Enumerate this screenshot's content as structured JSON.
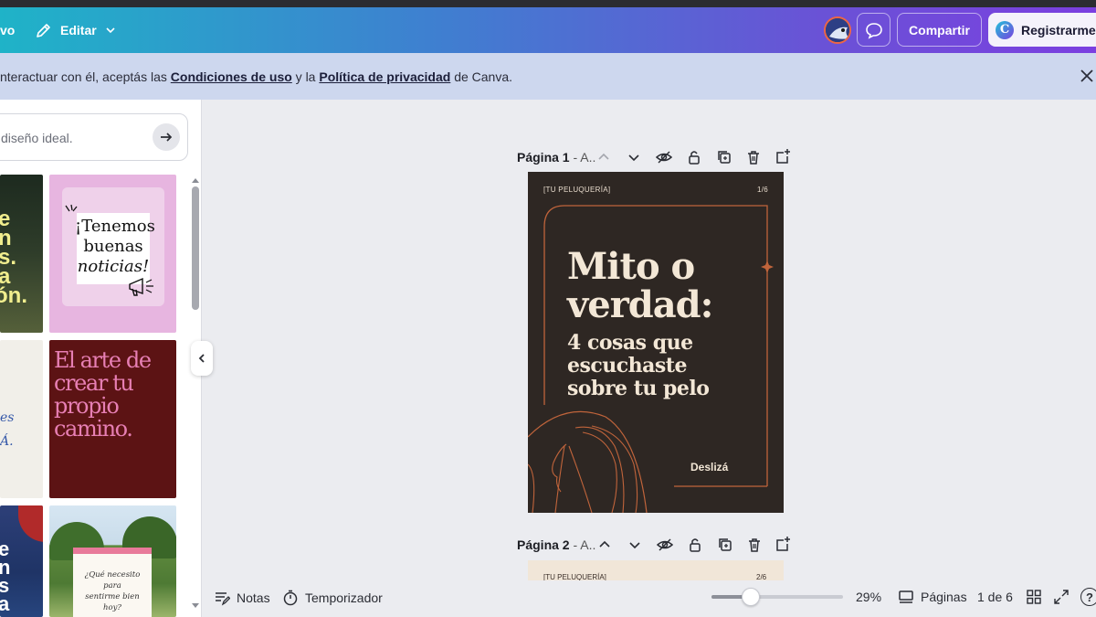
{
  "header": {
    "partial_menu": "vo",
    "edit_label": "Editar",
    "share_label": "Compartir",
    "register_label": "Registrarme",
    "brand_initial": "C"
  },
  "banner": {
    "text_before": "nteractuar con él, aceptás las ",
    "terms_link": "Condiciones de uso",
    "text_middle": " y la ",
    "privacy_link": "Política de privacidad",
    "text_after": " de Canva."
  },
  "left_panel": {
    "search_placeholder": "diseño ideal.",
    "templates": [
      {
        "lines": [
          "e",
          "n",
          "s.",
          "a",
          "ón."
        ]
      },
      {
        "lines": [
          "¡Tenemos",
          "buenas",
          "noticias!"
        ]
      },
      {
        "lines": [
          "es",
          "Á."
        ]
      },
      {
        "lines": [
          "El arte de",
          "crear tu",
          "propio",
          "camino."
        ]
      },
      {
        "lines": [
          "e",
          "n",
          "s",
          "a"
        ]
      },
      {
        "lines": [
          "¿Qué necesito para",
          "sentirme bien hoy?"
        ]
      }
    ]
  },
  "canvas": {
    "page1_label": "Página 1",
    "page1_suffix": " - A..",
    "page2_label": "Página 2",
    "page2_suffix": " - A..",
    "design": {
      "brand": "[TU PELUQUERÍA]",
      "counter": "1/6",
      "title_line1": "Mito o",
      "title_line2": "verdad:",
      "sub_line1": "4 cosas que",
      "sub_line2": "escuchaste",
      "sub_line3": "sobre tu pelo",
      "swipe": "Deslizá"
    },
    "page2": {
      "brand": "[TU PELUQUERÍA]",
      "counter": "2/6"
    }
  },
  "bottom_bar": {
    "notes_label": "Notas",
    "timer_label": "Temporizador",
    "zoom": "29%",
    "pages_label": "Páginas",
    "page_count": "1 de 6",
    "help": "?"
  },
  "colors": {
    "header_start": "#1fb3c8",
    "header_end": "#7b3fe0",
    "design_bg": "#2e2723",
    "design_accent": "#c0643b"
  }
}
